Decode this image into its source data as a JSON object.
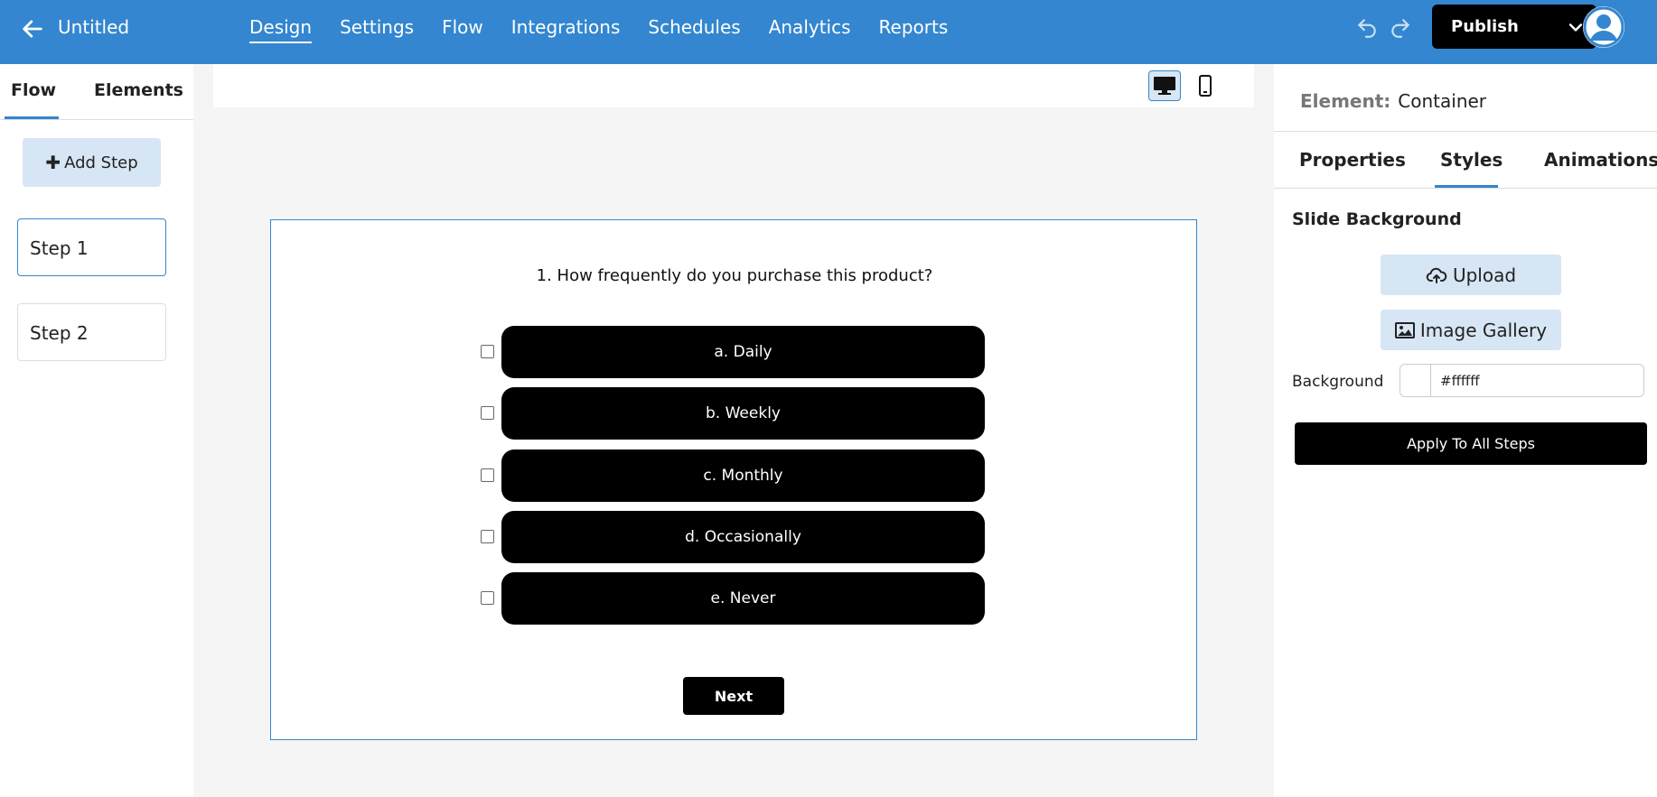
{
  "topbar": {
    "title": "Untitled",
    "nav": [
      "Design",
      "Settings",
      "Flow",
      "Integrations",
      "Schedules",
      "Analytics",
      "Reports"
    ],
    "active_nav": "Design",
    "publish_label": "Publish",
    "accent_color": "#3386cf"
  },
  "left_panel": {
    "tabs": [
      "Flow",
      "Elements"
    ],
    "active_tab": "Flow",
    "add_step_label": "Add Step",
    "steps": [
      "Step 1",
      "Step 2"
    ],
    "selected_step": "Step 1"
  },
  "canvas": {
    "view_modes": [
      "desktop",
      "mobile"
    ],
    "active_view": "desktop",
    "question": "1. How frequently do you purchase this product?",
    "options": [
      "a. Daily",
      "b. Weekly",
      "c. Monthly",
      "d. Occasionally",
      "e. Never"
    ],
    "next_label": "Next"
  },
  "right_panel": {
    "element_label": "Element:",
    "element_value": "Container",
    "tabs": [
      "Properties",
      "Styles",
      "Animations"
    ],
    "active_tab": "Styles",
    "section_title": "Slide Background",
    "upload_label": "Upload",
    "gallery_label": "Image Gallery",
    "background_label": "Background",
    "background_value": "#ffffff",
    "apply_label": "Apply To All Steps"
  },
  "icons": [
    "back-arrow-icon",
    "undo-icon",
    "redo-icon",
    "chevron-down-icon",
    "user-avatar-icon",
    "desktop-icon",
    "mobile-icon",
    "plus-icon",
    "cloud-upload-icon",
    "image-icon"
  ]
}
